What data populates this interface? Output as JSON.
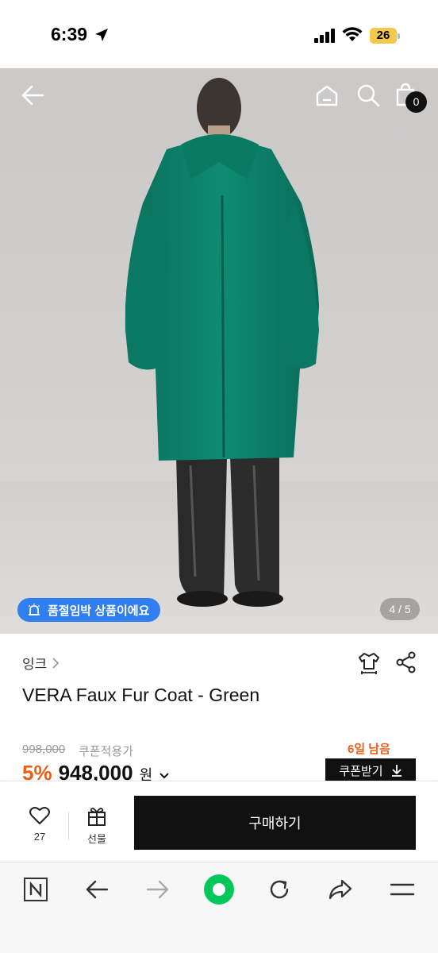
{
  "status_bar": {
    "time": "6:39",
    "battery": "26"
  },
  "hero": {
    "soldout_label": "품절임박 상품이에요",
    "page_indicator": "4 / 5",
    "cart_count": "0"
  },
  "product": {
    "brand": "잉크",
    "name": "VERA Faux Fur Coat - Green",
    "original_price": "998,000",
    "coupon_note": "쿠폰적용가",
    "days_left": "6일 남음",
    "discount": "5%",
    "sale_price": "948,000",
    "currency": "원",
    "coupon_button": "쿠폰받기"
  },
  "purchase_bar": {
    "like_count": "27",
    "gift_label": "선물",
    "buy_label": "구매하기"
  },
  "icons": {
    "back": "back-arrow-icon",
    "home": "home-icon",
    "search": "search-icon",
    "cart": "shopping-bag-icon",
    "alarm": "alarm-icon",
    "size": "size-guide-icon",
    "share": "share-icon",
    "heart": "heart-icon",
    "gift": "gift-icon",
    "browser_home": "naver-n-icon",
    "browser_back": "back-icon",
    "browser_forward": "forward-icon",
    "browser_green": "green-circle-icon",
    "browser_refresh": "refresh-icon",
    "browser_share": "share-arrow-icon",
    "browser_menu": "menu-icon"
  },
  "colors": {
    "accent_orange": "#e8601c",
    "badge_blue": "#2f7ff0",
    "naver_green": "#03c75a",
    "coat_green": "#0a8a70"
  }
}
